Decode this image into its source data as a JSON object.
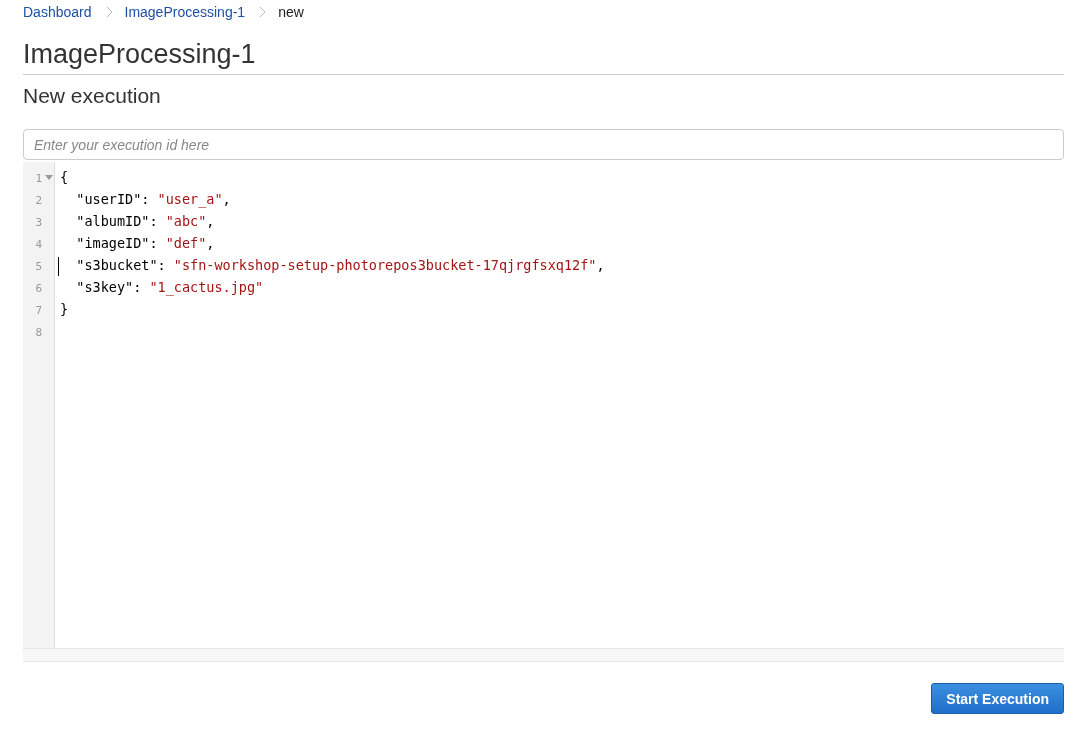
{
  "breadcrumb": [
    {
      "label": "Dashboard",
      "link": true
    },
    {
      "label": "ImageProcessing-1",
      "link": true
    },
    {
      "label": "new",
      "link": false
    }
  ],
  "title": "ImageProcessing-1",
  "subtitle": "New execution",
  "execution_id": {
    "placeholder": "Enter your execution id here"
  },
  "editor": {
    "lines": [
      {
        "number": "1",
        "foldable": true,
        "cursor": false,
        "tokens": [
          {
            "kind": "punct",
            "text": "{"
          }
        ]
      },
      {
        "number": "2",
        "foldable": false,
        "cursor": false,
        "tokens": [
          {
            "kind": "key",
            "text": "  \"userID\": "
          },
          {
            "kind": "string",
            "text": "\"user_a\""
          },
          {
            "kind": "punct",
            "text": ","
          }
        ]
      },
      {
        "number": "3",
        "foldable": false,
        "cursor": false,
        "tokens": [
          {
            "kind": "key",
            "text": "  \"albumID\": "
          },
          {
            "kind": "string",
            "text": "\"abc\""
          },
          {
            "kind": "punct",
            "text": ","
          }
        ]
      },
      {
        "number": "4",
        "foldable": false,
        "cursor": false,
        "tokens": [
          {
            "kind": "key",
            "text": "  \"imageID\": "
          },
          {
            "kind": "string",
            "text": "\"def\""
          },
          {
            "kind": "punct",
            "text": ","
          }
        ]
      },
      {
        "number": "5",
        "foldable": false,
        "cursor": true,
        "tokens": [
          {
            "kind": "key",
            "text": "  \"s3bucket\": "
          },
          {
            "kind": "string",
            "text": "\"sfn-workshop-setup-photorepos3bucket-17qjrgfsxq12f\""
          },
          {
            "kind": "punct",
            "text": ","
          }
        ]
      },
      {
        "number": "6",
        "foldable": false,
        "cursor": false,
        "tokens": [
          {
            "kind": "key",
            "text": "  \"s3key\": "
          },
          {
            "kind": "string",
            "text": "\"1_cactus.jpg\""
          }
        ]
      },
      {
        "number": "7",
        "foldable": false,
        "cursor": false,
        "tokens": [
          {
            "kind": "punct",
            "text": "}"
          }
        ]
      },
      {
        "number": "8",
        "foldable": false,
        "cursor": false
      }
    ]
  },
  "buttons": [
    "Start Execution"
  ]
}
